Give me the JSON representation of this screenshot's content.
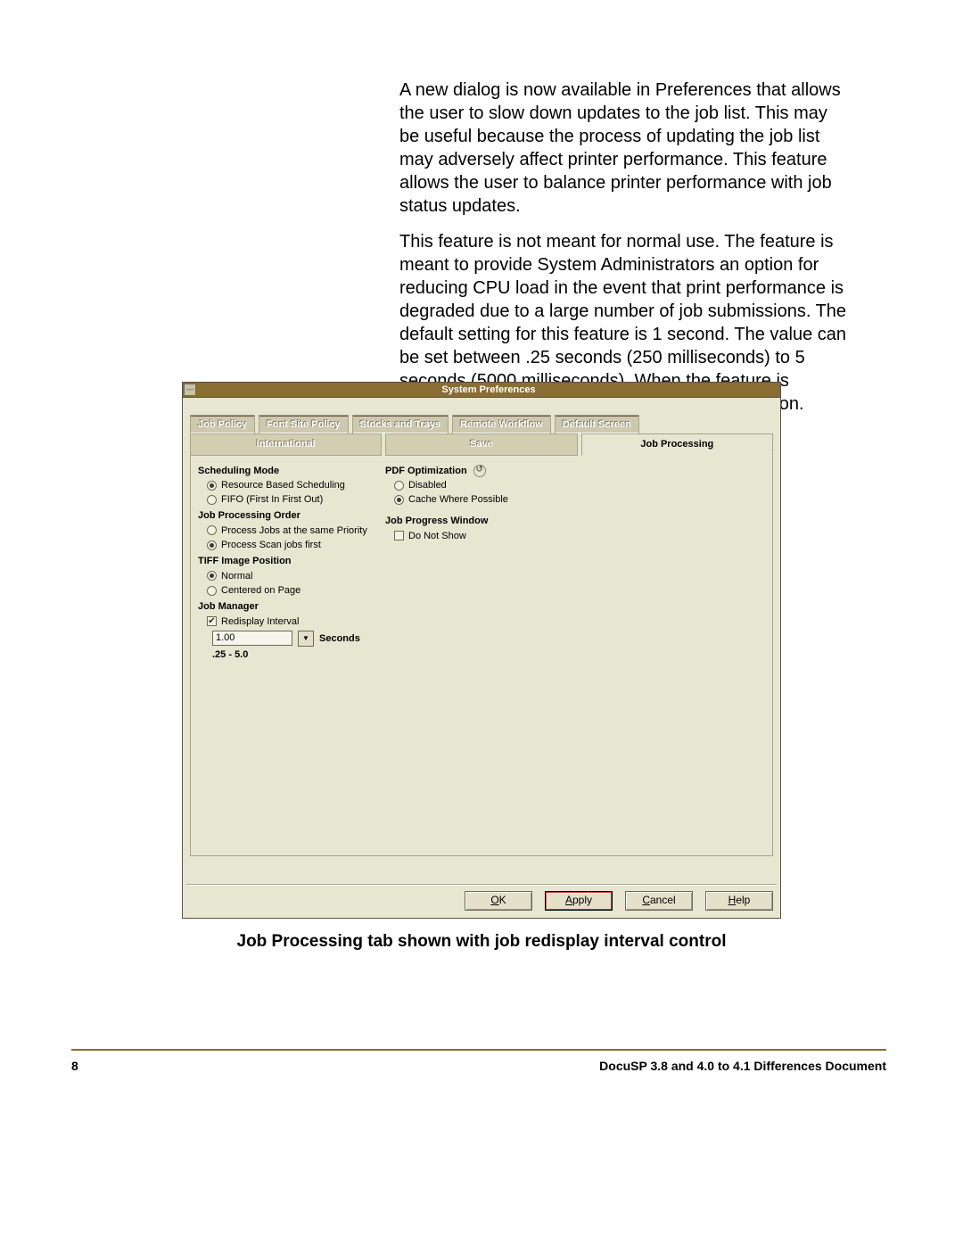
{
  "paragraphs": {
    "p1": "A new dialog is now available in Preferences that allows the user to slow down updates to the job list. This may be useful because the process of updating the job list may adversely affect printer performance. This feature allows the user to balance printer performance with job status updates.",
    "p2": "This feature is not meant for normal use.  The feature is meant to provide System Administrators an option for reducing CPU load in the event that print performance is degraded due to a large number of job submissions.  The default setting for this feature is 1 second. The value can be set between .25 seconds (250 milliseconds) to 5 seconds (5000 milliseconds). When the feature is disabled, updates are posted in a real-time fashion."
  },
  "dialog": {
    "title": "System Preferences",
    "tabs_row1": [
      "Job Policy",
      "Font Site Policy",
      "Stocks and Trays",
      "Remote Workflow",
      "Default Screen"
    ],
    "tabs_row2": [
      "International",
      "Save",
      "Job Processing"
    ],
    "active_row2_index": 2,
    "left": {
      "scheduling_mode": {
        "title": "Scheduling Mode",
        "opt1": "Resource Based Scheduling",
        "opt2": "FIFO (First In First Out)",
        "selected": 0
      },
      "job_processing_order": {
        "title": "Job Processing Order",
        "opt1": "Process Jobs at the same Priority",
        "opt2": "Process Scan jobs first",
        "selected": 1
      },
      "tiff_image_position": {
        "title": "TIFF Image Position",
        "opt1": "Normal",
        "opt2": "Centered on Page",
        "selected": 0
      },
      "job_manager": {
        "title": "Job Manager",
        "check_label": "Redisplay Interval",
        "checked": true,
        "value": "1.00",
        "unit": "Seconds",
        "range": ".25 - 5.0"
      }
    },
    "right": {
      "pdf_optimization": {
        "title": "PDF Optimization",
        "opt1": "Disabled",
        "opt2": "Cache Where Possible",
        "selected": 1
      },
      "job_progress_window": {
        "title": "Job Progress Window",
        "check_label": "Do Not Show",
        "checked": false
      }
    },
    "buttons": {
      "ok": "OK",
      "apply": "Apply",
      "cancel": "Cancel",
      "help": "Help"
    }
  },
  "caption": "Job Processing tab shown with job redisplay interval control",
  "footer": {
    "page": "8",
    "doc": "DocuSP 3.8 and 4.0 to 4.1 Differences Document"
  }
}
